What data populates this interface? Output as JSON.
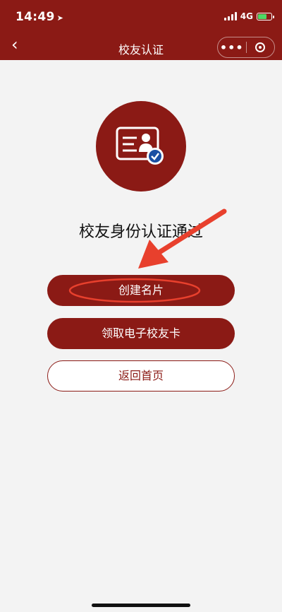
{
  "status": {
    "time": "14:49",
    "network": "4G"
  },
  "nav": {
    "back_icon": "‹",
    "title": "校友认证",
    "more_icon": "•••"
  },
  "main": {
    "heading": "校友身份认证通过",
    "buttons": {
      "create_card": "创建名片",
      "get_alumni_card": "领取电子校友卡",
      "back_home": "返回首页"
    }
  },
  "colors": {
    "brand": "#8b1a15",
    "annotation": "#e8402d",
    "background": "#f3f3f3"
  }
}
